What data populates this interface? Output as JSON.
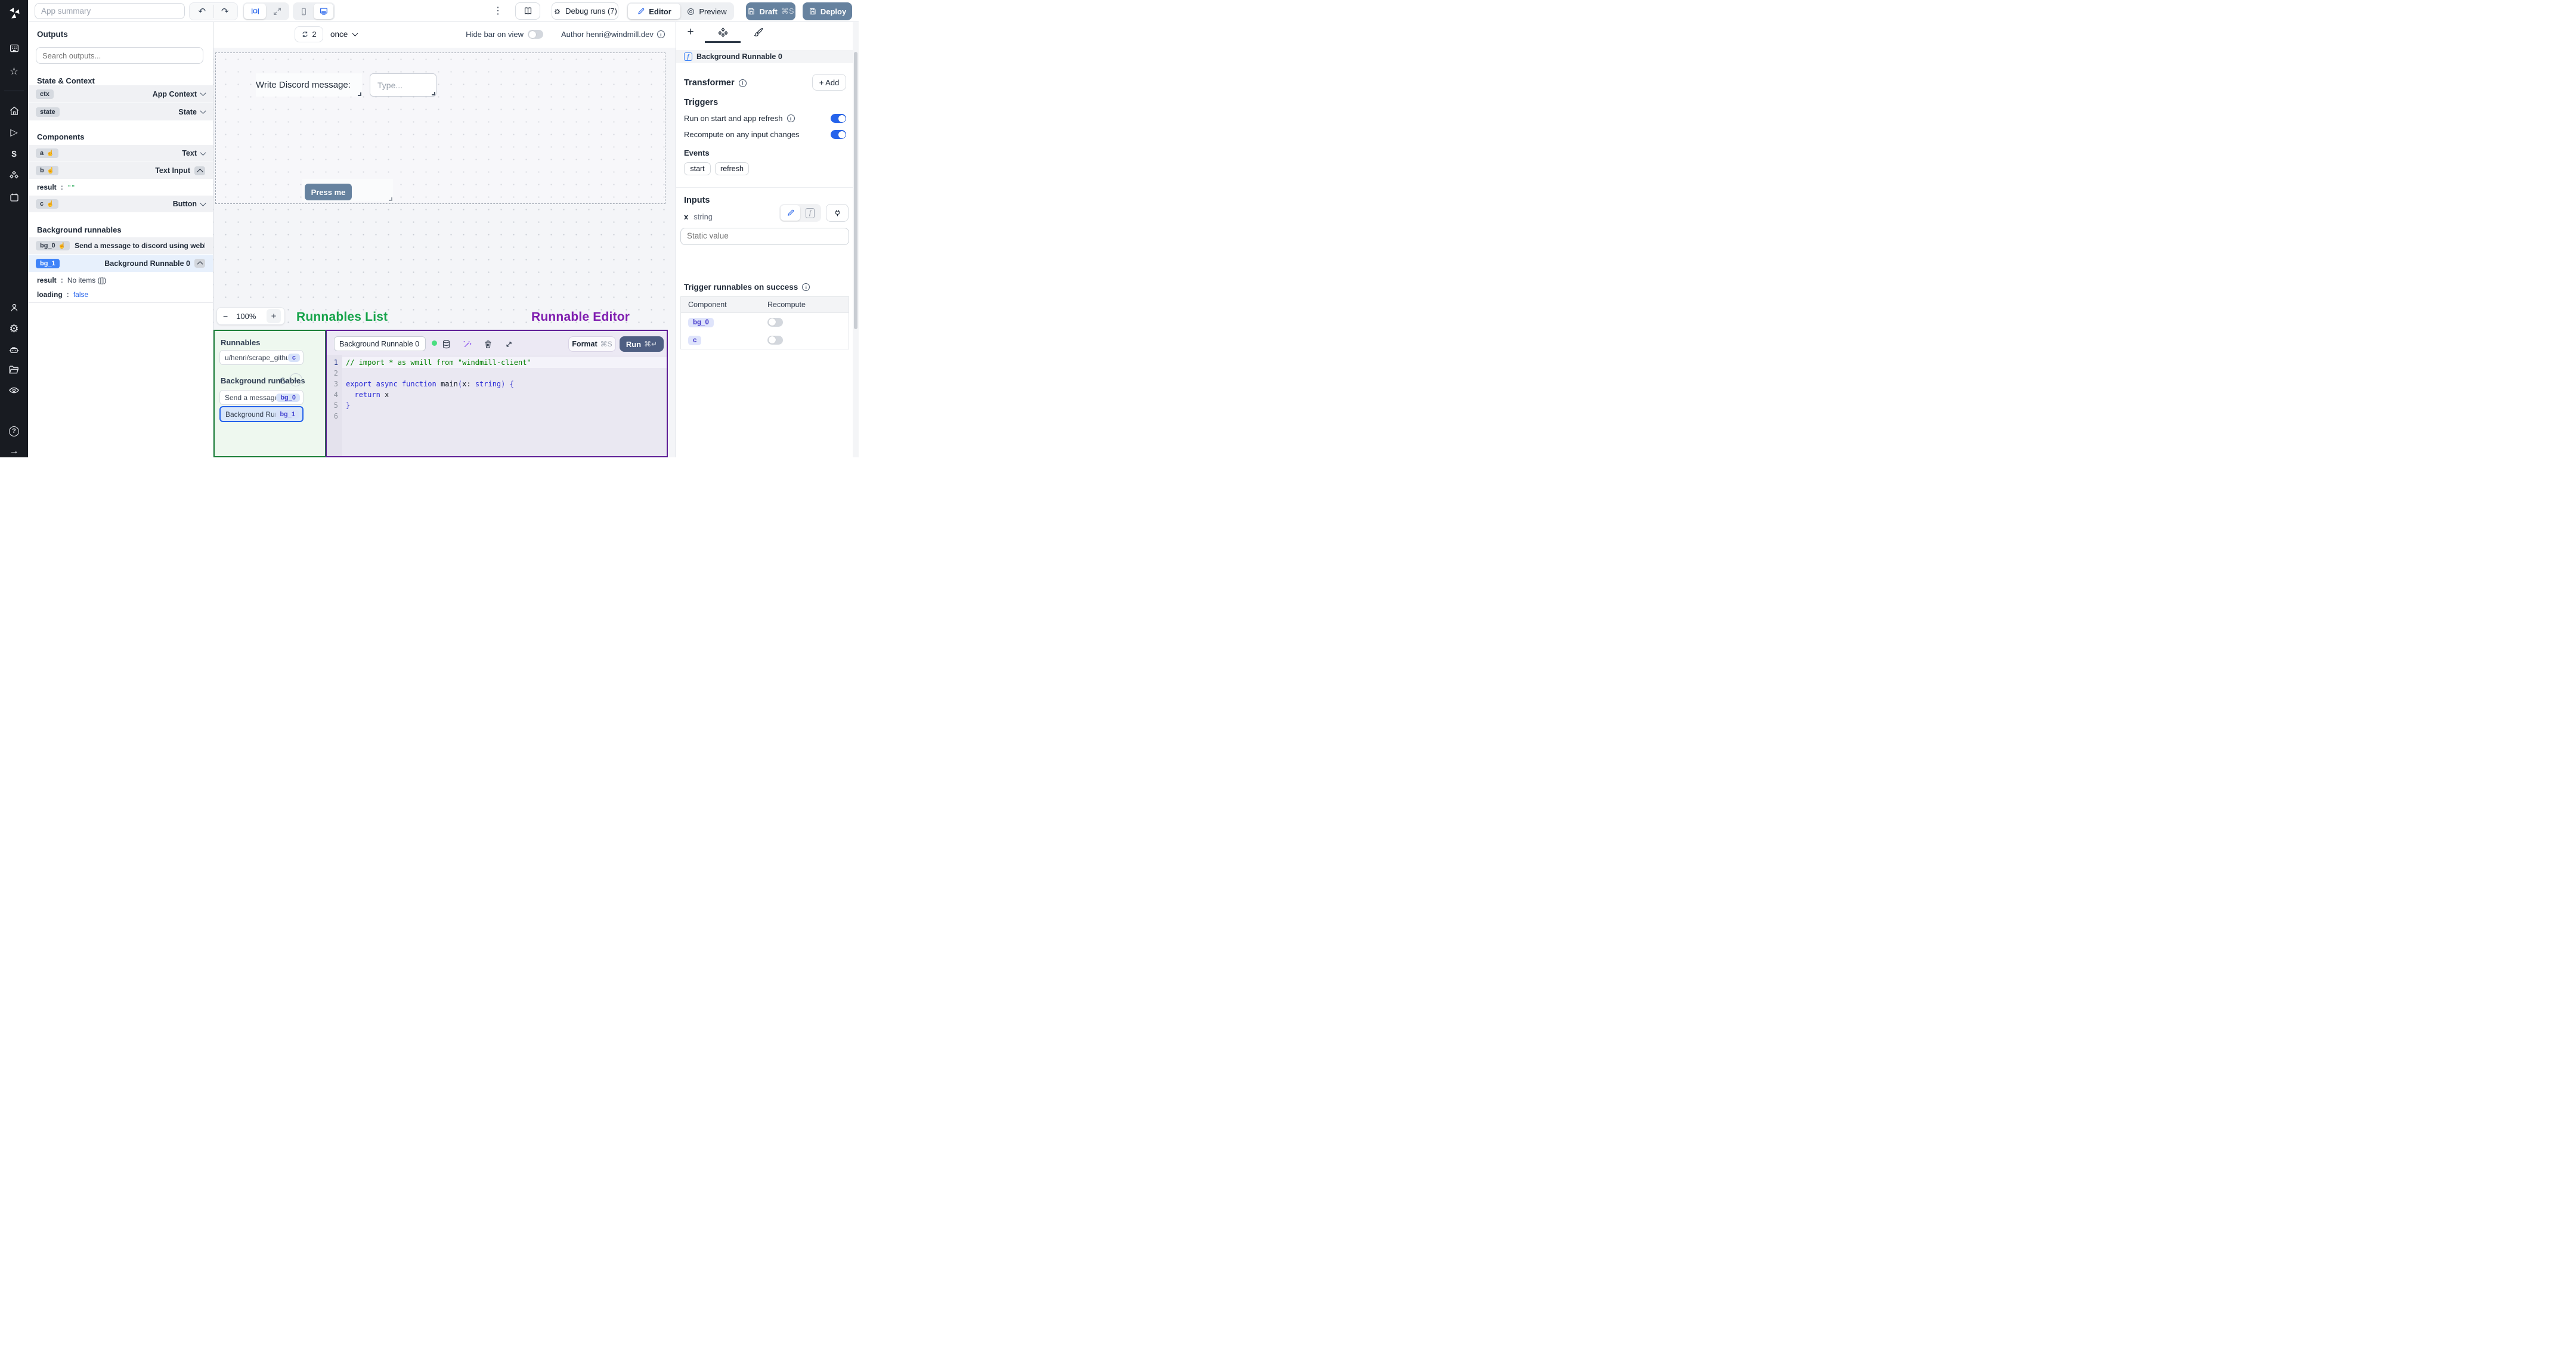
{
  "topbar": {
    "app_summary_placeholder": "App summary",
    "debug_runs_label": "Debug runs (7)",
    "editor_label": "Editor",
    "preview_label": "Preview",
    "draft_label": "Draft",
    "draft_shortcut": "⌘S",
    "deploy_label": "Deploy"
  },
  "canvas_toolbar": {
    "refresh_count": "2",
    "interval_label": "once",
    "hide_bar_label": "Hide bar on view",
    "author_label": "Author henri@windmill.dev"
  },
  "outputs": {
    "title": "Outputs",
    "search_placeholder": "Search outputs...",
    "section_state_context": "State & Context",
    "section_components": "Components",
    "section_background": "Background runnables",
    "ctx": {
      "id": "ctx",
      "type": "App Context"
    },
    "state": {
      "id": "state",
      "type": "State"
    },
    "a": {
      "id": "a",
      "type": "Text"
    },
    "b": {
      "id": "b",
      "type": "Text Input"
    },
    "b_result": {
      "key": "result",
      "value": "\"\""
    },
    "c": {
      "id": "c",
      "type": "Button"
    },
    "bg0": {
      "id": "bg_0",
      "label": "Send a message to discord using webhoo"
    },
    "bg1": {
      "id": "bg_1",
      "label": "Background Runnable 0"
    },
    "bg1_result": {
      "key": "result",
      "value": "No items ([])"
    },
    "bg1_loading": {
      "key": "loading",
      "value": "false"
    }
  },
  "canvas": {
    "text_component": "Write Discord message:",
    "input_placeholder": "Type...",
    "button_label": "Press me",
    "zoom_out": "−",
    "zoom_level": "100%",
    "zoom_in": "+"
  },
  "annotations": {
    "runnables_list": "Runnables List",
    "runnable_editor": "Runnable Editor"
  },
  "runnables_panel": {
    "title": "Runnables",
    "item_script": {
      "label": "u/henri/scrape_githu...",
      "badge": "c"
    },
    "bg_section": "Background runnables",
    "item_bg0": {
      "label": "Send a message...",
      "badge": "bg_0"
    },
    "item_bg1": {
      "label": "Background Run...",
      "badge": "bg_1"
    }
  },
  "editor_panel": {
    "name_value": "Background Runnable 0",
    "format_label": "Format",
    "format_shortcut": "⌘S",
    "run_label": "Run",
    "run_shortcut": "⌘↵",
    "code": {
      "lines": [
        {
          "num": "1",
          "active": true,
          "tokens": [
            {
              "c": "com",
              "t": "// import * as wmill from \"windmill-client\""
            }
          ]
        },
        {
          "num": "2",
          "tokens": []
        },
        {
          "num": "3",
          "tokens": [
            {
              "c": "kw",
              "t": "export"
            },
            {
              "c": "pl",
              "t": " "
            },
            {
              "c": "kw",
              "t": "async"
            },
            {
              "c": "pl",
              "t": " "
            },
            {
              "c": "kw",
              "t": "function"
            },
            {
              "c": "pl",
              "t": " "
            },
            {
              "c": "id",
              "t": "main"
            },
            {
              "c": "br",
              "t": "("
            },
            {
              "c": "id",
              "t": "x"
            },
            {
              "c": "pl",
              "t": ": "
            },
            {
              "c": "kw",
              "t": "string"
            },
            {
              "c": "br",
              "t": ")"
            },
            {
              "c": "pl",
              "t": " "
            },
            {
              "c": "br",
              "t": "{"
            }
          ]
        },
        {
          "num": "4",
          "tokens": [
            {
              "c": "pl",
              "t": "  "
            },
            {
              "c": "kw",
              "t": "return"
            },
            {
              "c": "pl",
              "t": " x"
            }
          ]
        },
        {
          "num": "5",
          "tokens": [
            {
              "c": "br",
              "t": "}"
            }
          ]
        },
        {
          "num": "6",
          "tokens": []
        }
      ]
    }
  },
  "right_panel": {
    "header": "Background Runnable 0",
    "transformer_label": "Transformer",
    "add_label": "+ Add",
    "triggers_title": "Triggers",
    "trigger_row_1": "Run on start and app refresh",
    "trigger_row_2": "Recompute on any input changes",
    "events_title": "Events",
    "event_pill_1": "start",
    "event_pill_2": "refresh",
    "inputs_title": "Inputs",
    "input_name": "x",
    "input_type": "string",
    "static_placeholder": "Static value",
    "trigger_success_title": "Trigger runnables on success",
    "table": {
      "col_1": "Component",
      "col_2": "Recompute",
      "row_1": {
        "component": "bg_0",
        "recompute": false
      },
      "row_2": {
        "component": "c",
        "recompute": false
      }
    }
  },
  "rail_icons": [
    "apps",
    "favorites",
    "home",
    "runs",
    "variables",
    "resources",
    "schedules",
    "users",
    "settings",
    "workers",
    "folders",
    "audit-logs",
    "help",
    "expand-sidebar"
  ],
  "colors": {
    "accent_blue": "#2563eb",
    "slate_button": "#66829f",
    "run_button": "#4e5e82",
    "annotation_green": "#16a34a",
    "annotation_purple": "#7f1daf",
    "panel_green_border": "#1a7f37",
    "panel_purple_border": "#5e1d96",
    "badge_blue": "#3f83f8",
    "rail_bg": "#181b21"
  }
}
